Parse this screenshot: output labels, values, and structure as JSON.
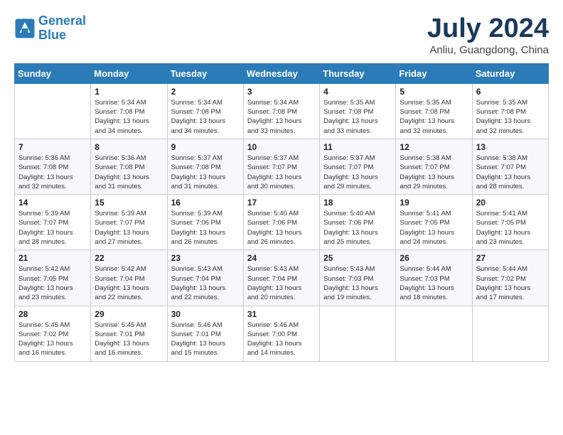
{
  "logo": {
    "line1": "General",
    "line2": "Blue"
  },
  "title": "July 2024",
  "location": "Anliu, Guangdong, China",
  "weekdays": [
    "Sunday",
    "Monday",
    "Tuesday",
    "Wednesday",
    "Thursday",
    "Friday",
    "Saturday"
  ],
  "weeks": [
    [
      {
        "day": "",
        "info": ""
      },
      {
        "day": "1",
        "info": "Sunrise: 5:34 AM\nSunset: 7:08 PM\nDaylight: 13 hours\nand 34 minutes."
      },
      {
        "day": "2",
        "info": "Sunrise: 5:34 AM\nSunset: 7:08 PM\nDaylight: 13 hours\nand 34 minutes."
      },
      {
        "day": "3",
        "info": "Sunrise: 5:34 AM\nSunset: 7:08 PM\nDaylight: 13 hours\nand 33 minutes."
      },
      {
        "day": "4",
        "info": "Sunrise: 5:35 AM\nSunset: 7:08 PM\nDaylight: 13 hours\nand 33 minutes."
      },
      {
        "day": "5",
        "info": "Sunrise: 5:35 AM\nSunset: 7:08 PM\nDaylight: 13 hours\nand 32 minutes."
      },
      {
        "day": "6",
        "info": "Sunrise: 5:35 AM\nSunset: 7:08 PM\nDaylight: 13 hours\nand 32 minutes."
      }
    ],
    [
      {
        "day": "7",
        "info": "Sunrise: 5:36 AM\nSunset: 7:08 PM\nDaylight: 13 hours\nand 32 minutes."
      },
      {
        "day": "8",
        "info": "Sunrise: 5:36 AM\nSunset: 7:08 PM\nDaylight: 13 hours\nand 31 minutes."
      },
      {
        "day": "9",
        "info": "Sunrise: 5:37 AM\nSunset: 7:08 PM\nDaylight: 13 hours\nand 31 minutes."
      },
      {
        "day": "10",
        "info": "Sunrise: 5:37 AM\nSunset: 7:07 PM\nDaylight: 13 hours\nand 30 minutes."
      },
      {
        "day": "11",
        "info": "Sunrise: 5:37 AM\nSunset: 7:07 PM\nDaylight: 13 hours\nand 29 minutes."
      },
      {
        "day": "12",
        "info": "Sunrise: 5:38 AM\nSunset: 7:07 PM\nDaylight: 13 hours\nand 29 minutes."
      },
      {
        "day": "13",
        "info": "Sunrise: 5:38 AM\nSunset: 7:07 PM\nDaylight: 13 hours\nand 28 minutes."
      }
    ],
    [
      {
        "day": "14",
        "info": "Sunrise: 5:39 AM\nSunset: 7:07 PM\nDaylight: 13 hours\nand 28 minutes."
      },
      {
        "day": "15",
        "info": "Sunrise: 5:39 AM\nSunset: 7:07 PM\nDaylight: 13 hours\nand 27 minutes."
      },
      {
        "day": "16",
        "info": "Sunrise: 5:39 AM\nSunset: 7:06 PM\nDaylight: 13 hours\nand 26 minutes."
      },
      {
        "day": "17",
        "info": "Sunrise: 5:40 AM\nSunset: 7:06 PM\nDaylight: 13 hours\nand 26 minutes."
      },
      {
        "day": "18",
        "info": "Sunrise: 5:40 AM\nSunset: 7:06 PM\nDaylight: 13 hours\nand 25 minutes."
      },
      {
        "day": "19",
        "info": "Sunrise: 5:41 AM\nSunset: 7:05 PM\nDaylight: 13 hours\nand 24 minutes."
      },
      {
        "day": "20",
        "info": "Sunrise: 5:41 AM\nSunset: 7:05 PM\nDaylight: 13 hours\nand 23 minutes."
      }
    ],
    [
      {
        "day": "21",
        "info": "Sunrise: 5:42 AM\nSunset: 7:05 PM\nDaylight: 13 hours\nand 23 minutes."
      },
      {
        "day": "22",
        "info": "Sunrise: 5:42 AM\nSunset: 7:04 PM\nDaylight: 13 hours\nand 22 minutes."
      },
      {
        "day": "23",
        "info": "Sunrise: 5:43 AM\nSunset: 7:04 PM\nDaylight: 13 hours\nand 22 minutes."
      },
      {
        "day": "24",
        "info": "Sunrise: 5:43 AM\nSunset: 7:04 PM\nDaylight: 13 hours\nand 20 minutes."
      },
      {
        "day": "25",
        "info": "Sunrise: 5:43 AM\nSunset: 7:03 PM\nDaylight: 13 hours\nand 19 minutes."
      },
      {
        "day": "26",
        "info": "Sunrise: 5:44 AM\nSunset: 7:03 PM\nDaylight: 13 hours\nand 18 minutes."
      },
      {
        "day": "27",
        "info": "Sunrise: 5:44 AM\nSunset: 7:02 PM\nDaylight: 13 hours\nand 17 minutes."
      }
    ],
    [
      {
        "day": "28",
        "info": "Sunrise: 5:45 AM\nSunset: 7:02 PM\nDaylight: 13 hours\nand 16 minutes."
      },
      {
        "day": "29",
        "info": "Sunrise: 5:45 AM\nSunset: 7:01 PM\nDaylight: 13 hours\nand 16 minutes."
      },
      {
        "day": "30",
        "info": "Sunrise: 5:46 AM\nSunset: 7:01 PM\nDaylight: 13 hours\nand 15 minutes."
      },
      {
        "day": "31",
        "info": "Sunrise: 5:46 AM\nSunset: 7:00 PM\nDaylight: 13 hours\nand 14 minutes."
      },
      {
        "day": "",
        "info": ""
      },
      {
        "day": "",
        "info": ""
      },
      {
        "day": "",
        "info": ""
      }
    ]
  ]
}
